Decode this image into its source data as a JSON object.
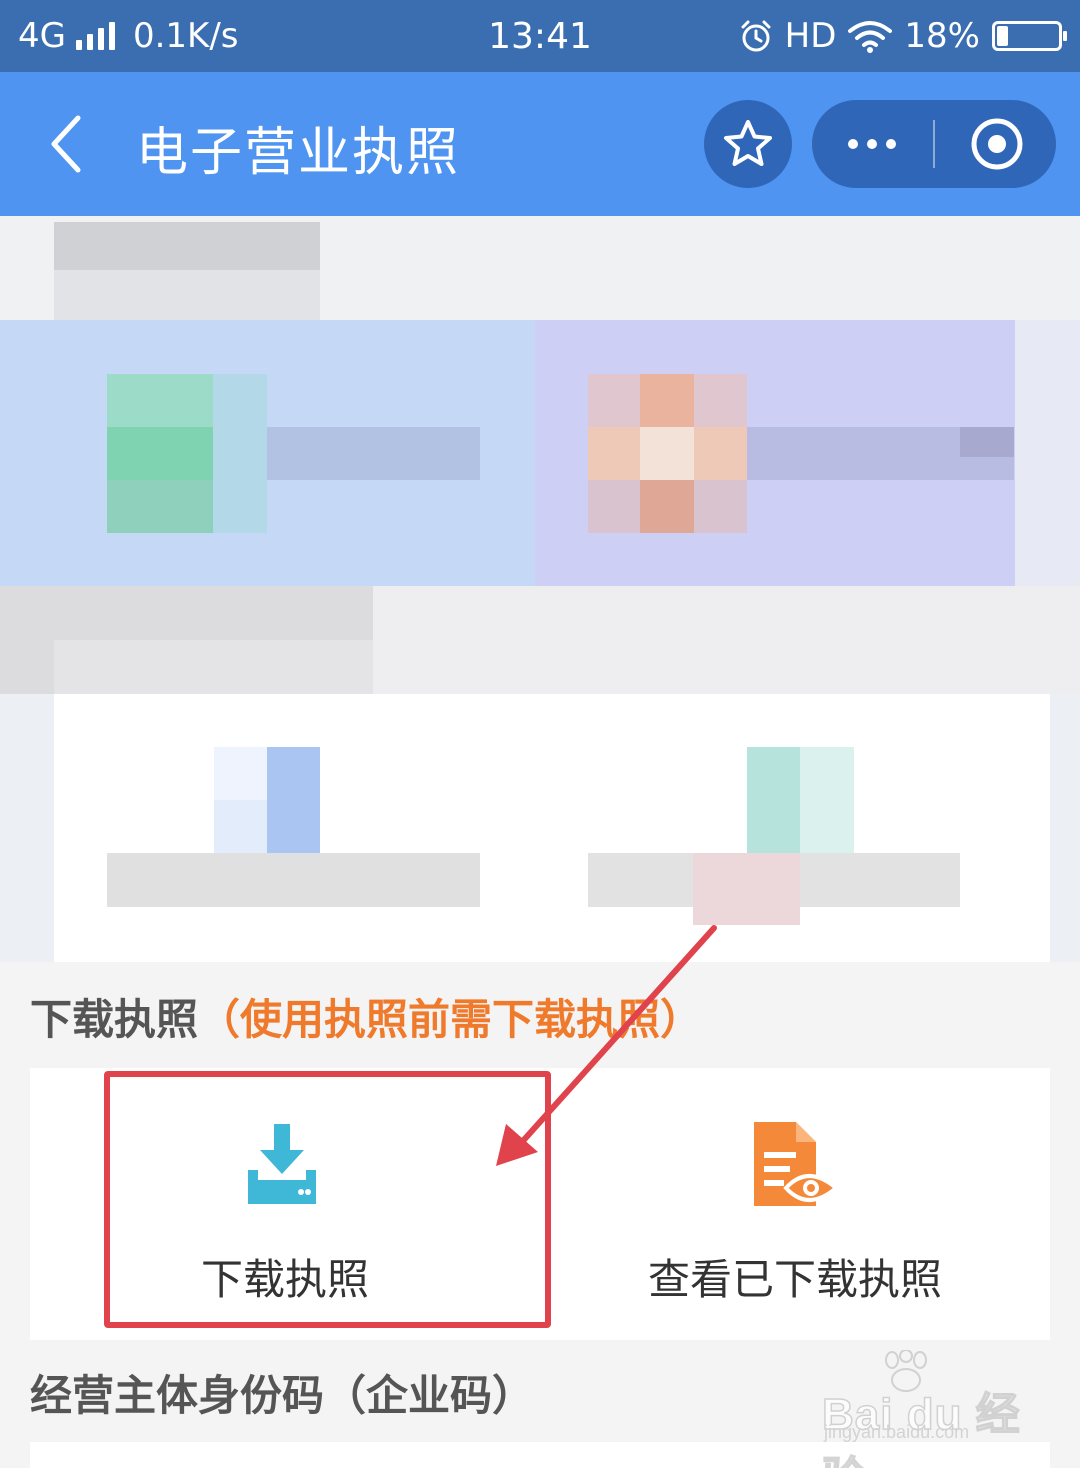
{
  "status_bar": {
    "network": "4G",
    "speed": "0.1K/s",
    "time": "13:41",
    "hd": "HD",
    "battery": "18%",
    "battery_level": 0.18
  },
  "nav": {
    "title": "电子营业执照",
    "back_icon": "chevron-left-icon",
    "favorite_icon": "star-icon",
    "more_icon": "more-dots-icon",
    "close_icon": "target-circle-icon"
  },
  "download_section": {
    "heading": "下载执照",
    "note": "（使用执照前需下载执照）",
    "download": {
      "label": "下载执照",
      "icon": "download-tray-icon",
      "color": "#3fb8d8"
    },
    "view_downloaded": {
      "label": "查看已下载执照",
      "icon": "document-eye-icon",
      "color": "#f5893a"
    }
  },
  "identity_section": {
    "heading": "经营主体身份码（企业码）"
  },
  "watermark": {
    "brand": "Bai du 经验",
    "site": "jingyan.baidu.com"
  },
  "colors": {
    "status_bar": "#3a6eb0",
    "nav_bar": "#4f94f0",
    "capsule": "#2f66b7",
    "highlight": "#e0434b",
    "note": "#f07a2c"
  }
}
